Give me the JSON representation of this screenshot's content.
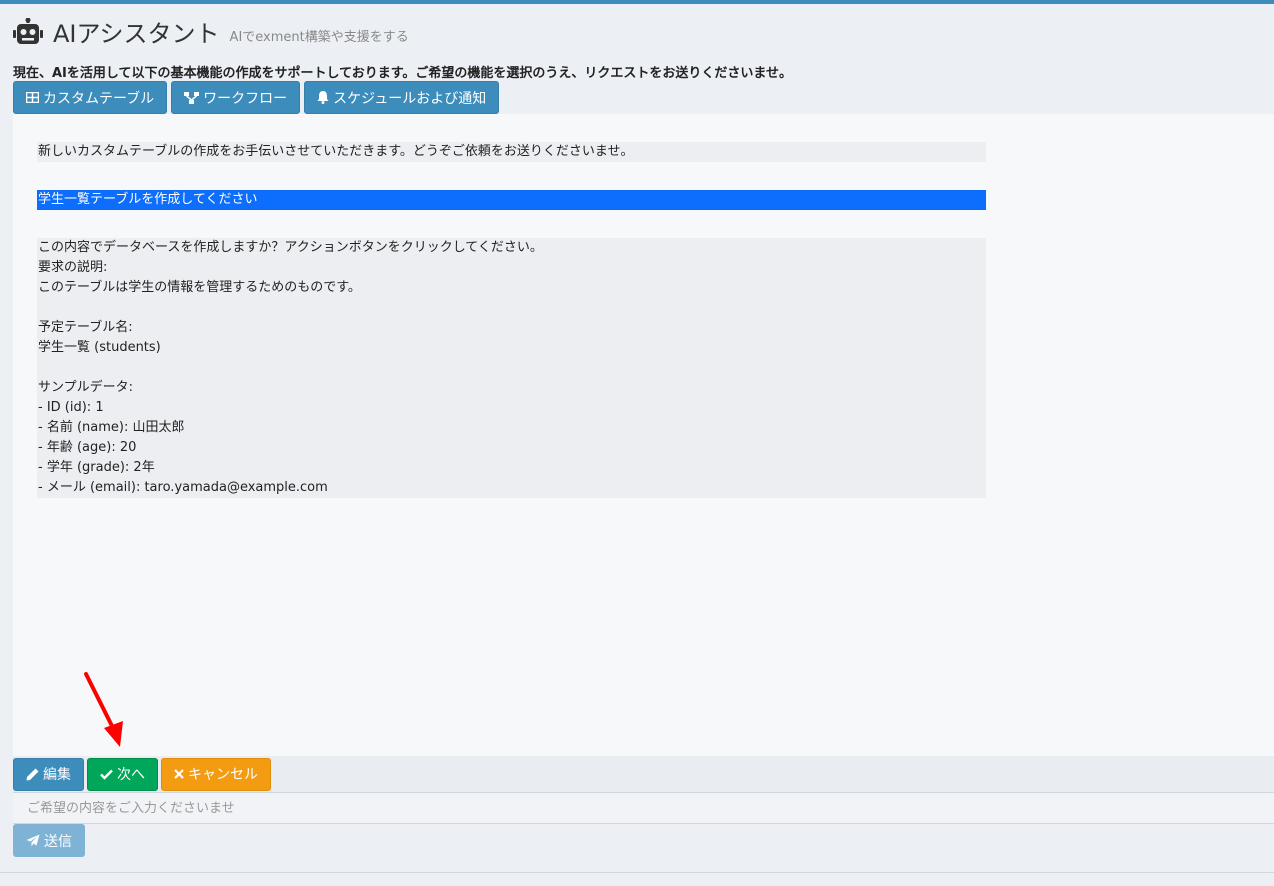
{
  "header": {
    "title": "AIアシスタント",
    "subtitle": "AIでexment構築や支援をする",
    "icon": "robot-icon"
  },
  "intro_text": "現在、AIを活用して以下の基本機能の作成をサポートしております。ご希望の機能を選択のうえ、リクエストをお送りくださいませ。",
  "feature_buttons": [
    {
      "label": "カスタムテーブル",
      "icon": "table-icon"
    },
    {
      "label": "ワークフロー",
      "icon": "sitemap-icon"
    },
    {
      "label": "スケジュールおよび通知",
      "icon": "bell-icon"
    }
  ],
  "messages": [
    {
      "role": "assistant",
      "text": "新しいカスタムテーブルの作成をお手伝いさせていただきます。どうぞご依頼をお送りくださいませ。"
    },
    {
      "role": "user",
      "text": "学生一覧テーブルを作成してください"
    },
    {
      "role": "assistant",
      "text": "この内容でデータベースを作成しますか？アクションボタンをクリックしてください。\n要求の説明:\nこのテーブルは学生の情報を管理するためのものです。\n\n予定テーブル名:\n学生一覧 (students)\n\nサンプルデータ:\n- ID (id): 1\n- 名前 (name): 山田太郎\n- 年齢 (age): 20\n- 学年 (grade): 2年\n- メール (email): taro.yamada@example.com"
    }
  ],
  "actions": {
    "edit_label": "編集",
    "next_label": "次へ",
    "cancel_label": "キャンセル"
  },
  "input": {
    "placeholder": "ご希望の内容をご入力くださいませ",
    "value": ""
  },
  "send_label": "送信",
  "colors": {
    "primary": "#3c8dbc",
    "success": "#00a65a",
    "warning": "#f39c12",
    "user_bubble": "#0d6efd",
    "annotation_arrow": "#ff0000"
  }
}
